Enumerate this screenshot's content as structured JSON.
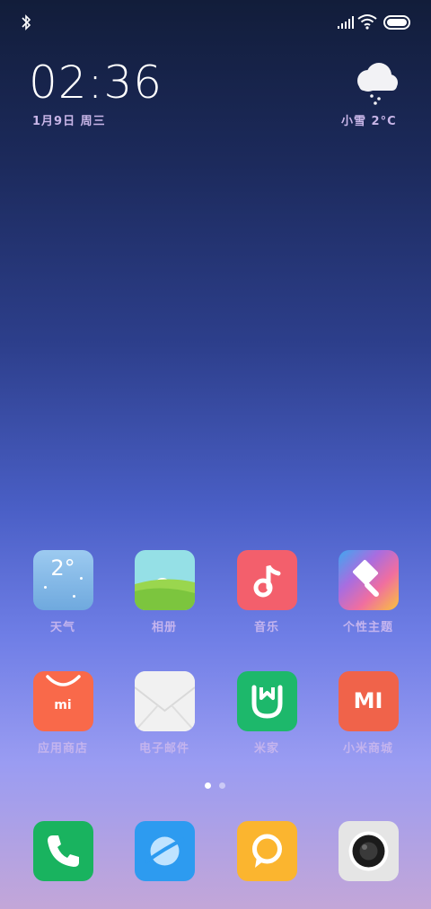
{
  "status_bar": {
    "icons": [
      "bluetooth-icon",
      "signal-icon",
      "wifi-icon",
      "battery-icon"
    ],
    "battery_level": 1.0
  },
  "clock": {
    "time": "02:36",
    "date": "1月9日 周三"
  },
  "weather_widget": {
    "condition": "小雪",
    "temperature": "2°C",
    "icon": "snow-cloud-icon"
  },
  "apps": [
    {
      "label": "天气",
      "icon": "weather-icon",
      "text": "2°",
      "color": "#7fb9e8"
    },
    {
      "label": "相册",
      "icon": "gallery-icon",
      "color": "#8bd36a"
    },
    {
      "label": "音乐",
      "icon": "music-icon",
      "color": "#f3606b"
    },
    {
      "label": "个性主题",
      "icon": "themes-icon",
      "color": "#e56bb0"
    },
    {
      "label": "应用商店",
      "icon": "app-store-icon",
      "text": "mi",
      "color": "#f9694a"
    },
    {
      "label": "电子邮件",
      "icon": "email-icon",
      "color": "#f0f0f0"
    },
    {
      "label": "米家",
      "icon": "mijia-icon",
      "color": "#1fb86a"
    },
    {
      "label": "小米商城",
      "icon": "mi-store-icon",
      "text": "MI",
      "color": "#f0634a"
    }
  ],
  "dock": [
    {
      "icon": "phone-icon",
      "color": "#18b45f"
    },
    {
      "icon": "browser-icon",
      "color": "#2e9cf0"
    },
    {
      "icon": "messages-icon",
      "color": "#fbb630"
    },
    {
      "icon": "camera-icon",
      "color": "#e6e6e6"
    }
  ],
  "page_indicator": {
    "pages": 2,
    "current": 1
  }
}
